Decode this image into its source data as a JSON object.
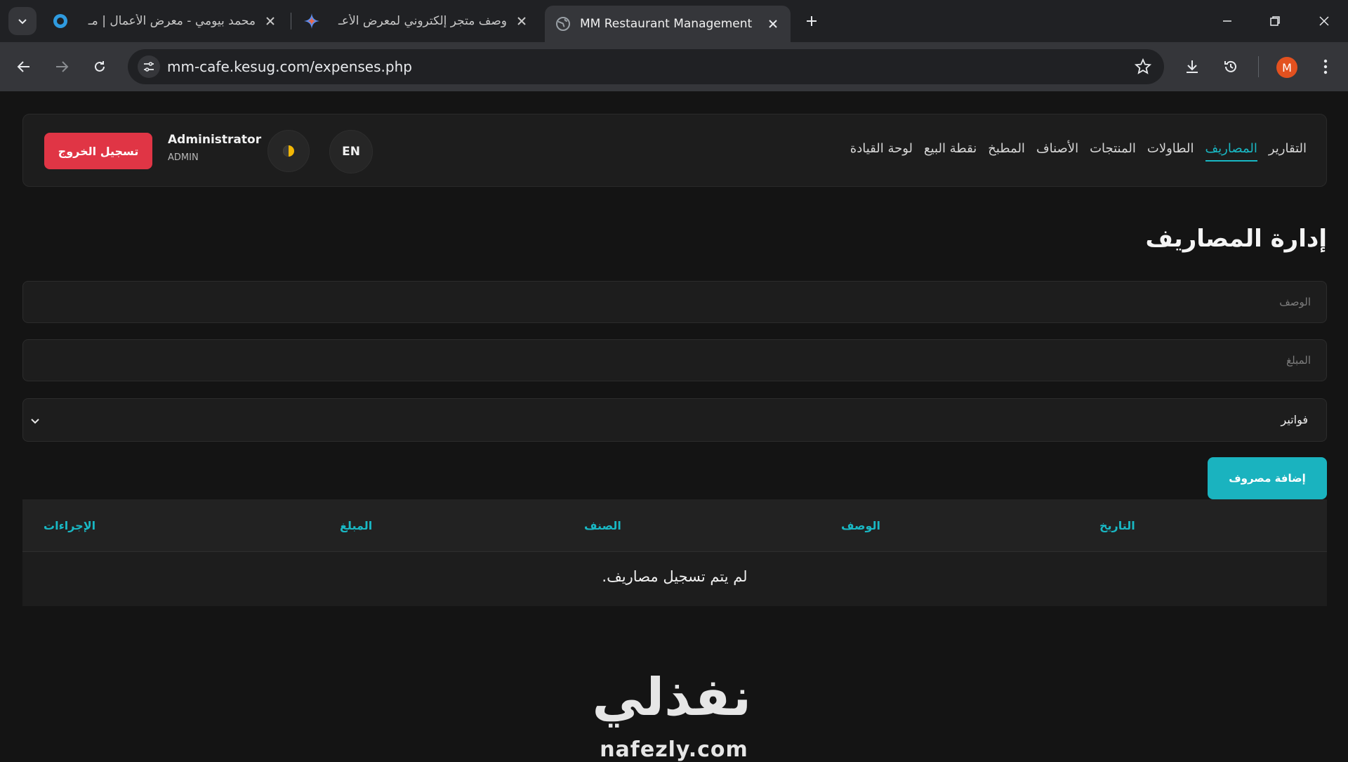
{
  "browser": {
    "tabs": [
      {
        "title": "محمد بيومي - معرض الأعمال | مـ",
        "icon": "circle-favicon"
      },
      {
        "title": "وصف متجر إلكتروني لمعرض الأعـ",
        "icon": "gemini-sparkle-icon"
      },
      {
        "title": "MM Restaurant Management",
        "icon": "globe-icon",
        "active": true
      }
    ],
    "url": "mm-cafe.kesug.com/expenses.php",
    "profile_initial": "M",
    "profile_color": "#e3511f"
  },
  "navbar": {
    "logout_label": "تسجيل الخروج",
    "user_name": "Administrator",
    "user_role": "ADMIN",
    "lang_label": "EN",
    "links": [
      {
        "label": "لوحة القيادة"
      },
      {
        "label": "نقطة البيع"
      },
      {
        "label": "المطبخ"
      },
      {
        "label": "الأصناف"
      },
      {
        "label": "المنتجات"
      },
      {
        "label": "الطاولات"
      },
      {
        "label": "المصاريف",
        "active": true
      },
      {
        "label": "التقارير"
      }
    ]
  },
  "main": {
    "title": "إدارة المصاريف",
    "description_placeholder": "الوصف",
    "amount_placeholder": "المبلغ",
    "category_selected": "فواتير",
    "add_button": "إضافة مصروف",
    "table": {
      "headers": [
        "التاريخ",
        "الوصف",
        "الصنف",
        "المبلغ",
        "الإجراءات"
      ],
      "empty_message": "لم يتم تسجيل مصاريف."
    }
  },
  "watermark": {
    "word": "نفذلي",
    "url": "nafezly.com"
  },
  "colors": {
    "accent": "#19b8c4",
    "danger": "#e03545",
    "background": "#141414",
    "card": "#1d1d1d"
  }
}
